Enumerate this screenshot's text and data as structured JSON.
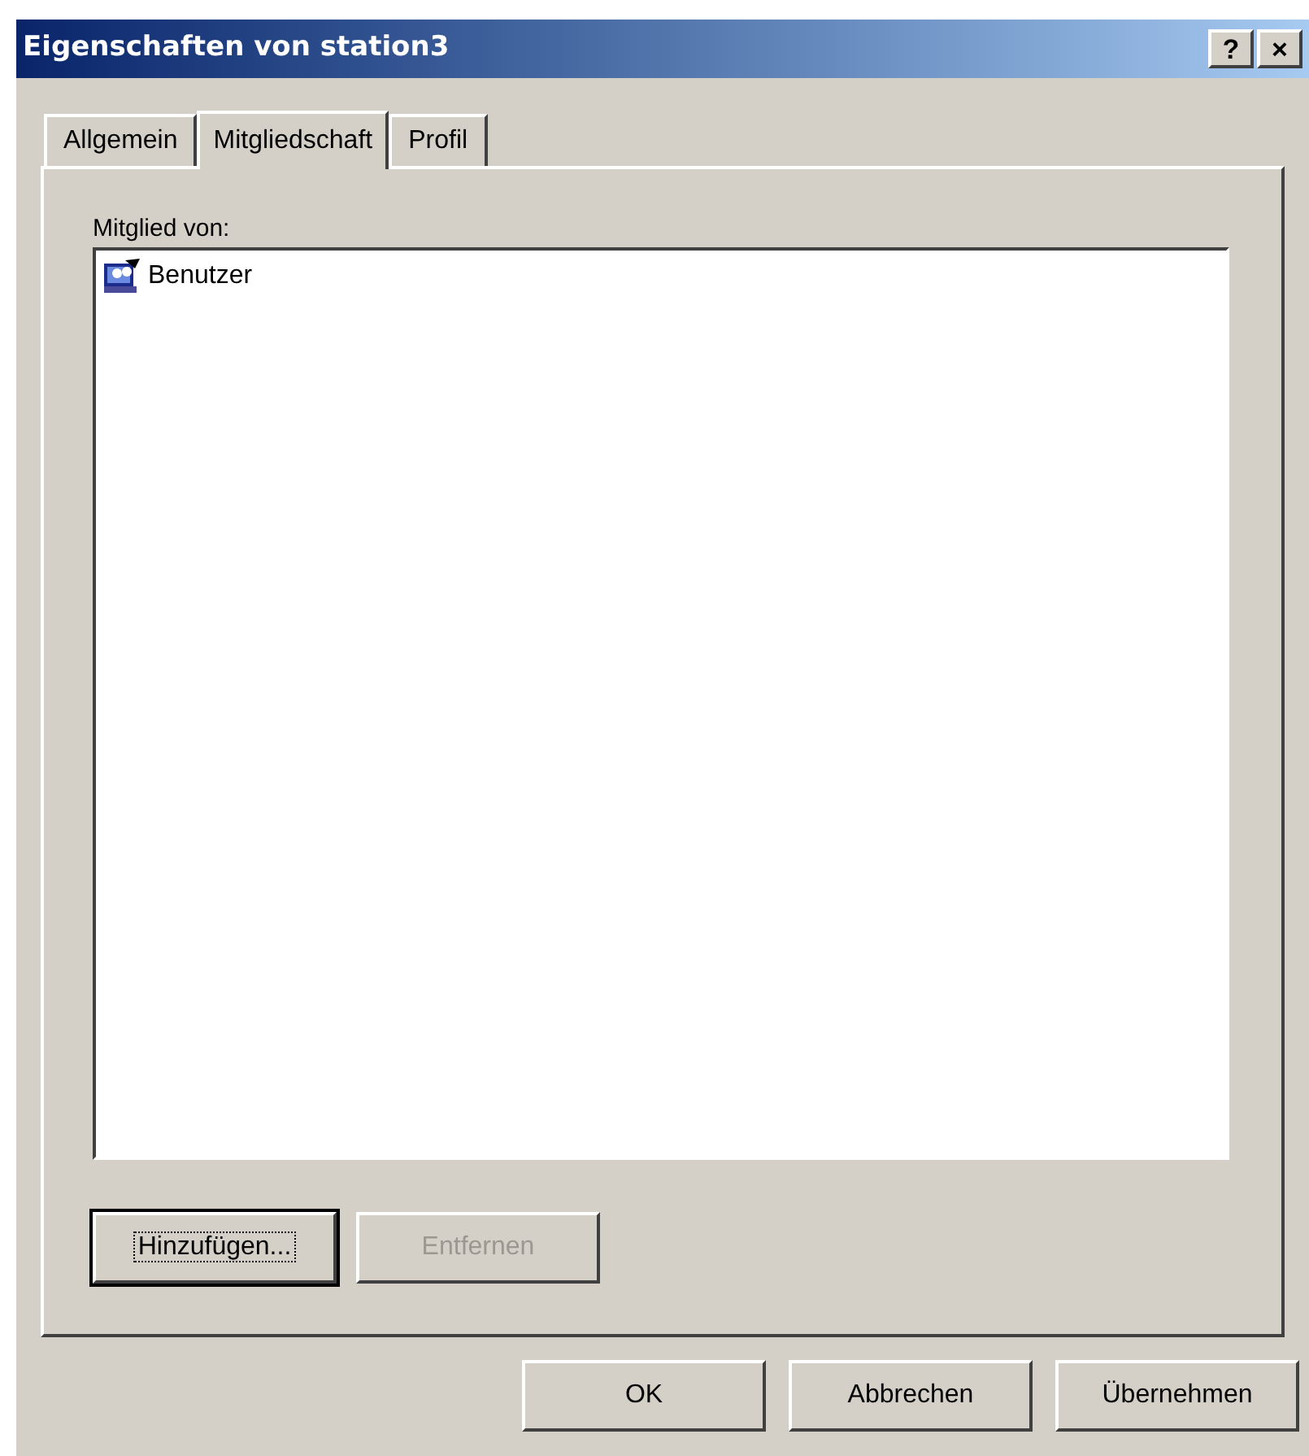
{
  "window": {
    "title": "Eigenschaften von station3",
    "title_buttons": [
      "?",
      "×"
    ]
  },
  "tabs": [
    {
      "label": "Allgemein",
      "selected": false
    },
    {
      "label": "Mitgliedschaft",
      "selected": true
    },
    {
      "label": "Profil",
      "selected": false
    }
  ],
  "member_list": {
    "label": "Mitglied von:",
    "items": [
      {
        "name": "Benutzer",
        "selected": false
      }
    ]
  },
  "list_buttons": [
    {
      "label": "Hinzufügen...",
      "disabled": false,
      "focused": true
    },
    {
      "label": "Entfernen",
      "disabled": true,
      "focused": false
    }
  ],
  "dialog_buttons": [
    {
      "label": "OK",
      "disabled": false
    },
    {
      "label": "Abbrechen",
      "disabled": false
    },
    {
      "label": "Übernehmen",
      "disabled": false
    }
  ]
}
